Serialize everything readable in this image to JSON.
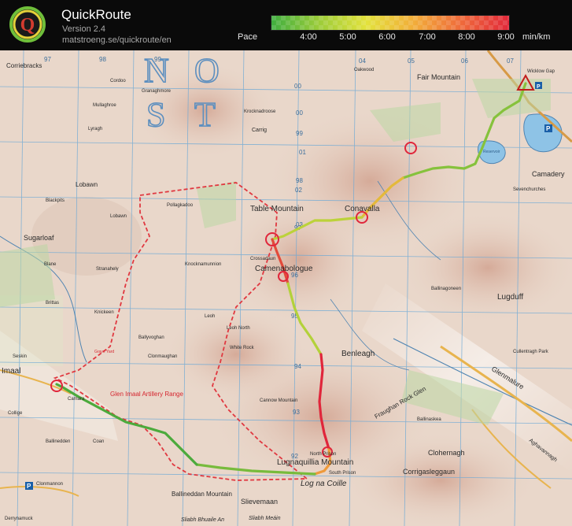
{
  "header": {
    "app_name": "QuickRoute",
    "version": "Version 2.4",
    "url": "matstroeng.se/quickroute/en",
    "pace_label": "Pace",
    "pace_ticks": [
      "4:00",
      "5:00",
      "6:00",
      "7:00",
      "8:00",
      "9:00"
    ],
    "pace_unit": "min/km",
    "pace_colors": [
      "#3fae3f",
      "#9ccc3a",
      "#e3e23c",
      "#f2ad3a",
      "#ef6a3b",
      "#e2283a"
    ],
    "logo_letter": "Q"
  },
  "map": {
    "colors": {
      "route_fast": "#4caa3c",
      "route_slow": "#e0263b",
      "range_boundary": "#e03840",
      "water": "#8ec3e6",
      "grid": "#6aa8d6"
    },
    "grid_labels_top": [
      "97",
      "98",
      "99",
      "00",
      "01",
      "02",
      "03",
      "04",
      "05",
      "06",
      "07"
    ],
    "grid_labels_left": [
      "00",
      "99",
      "98",
      "97",
      "96",
      "95",
      "94",
      "93",
      "92"
    ],
    "letters": [
      "N",
      "O",
      "S",
      "T"
    ],
    "places": {
      "corriebracks": "Corriebracks",
      "cordoo": "Cordoo",
      "granaghmore": "Granaghmore",
      "mullaghroe": "Mullaghroe",
      "lyragh": "Lyragh",
      "oakwood": "Oakwood",
      "fair_mountain": "Fair Mountain",
      "wicklow_gap": "Wicklow Gap",
      "krocknadroose": "Krocknadroose",
      "carrig": "Carrig",
      "camaderry": "Camadery",
      "sevenchurches": "Sevenchurches",
      "lobawn": "Lobawn",
      "lobawn_small": "Lobawn",
      "blackpits": "Blackpits",
      "pollagkadoo": "Pollagkadoo",
      "table_mountain": "Table Mountain",
      "conavalla": "Conavalla",
      "sugarloaf": "Sugarloaf",
      "blane": "Blane",
      "stranahely": "Stranahely",
      "camenabologue": "Camenabologue",
      "crossadaun": "Crossadaun",
      "knocknamunnion": "Knocknamunnion",
      "ballinagoneen": "Ballinagoneen",
      "lugduff": "Lugduff",
      "brittas": "Brittas",
      "knickeen": "Knickeen",
      "leoh": "Leoh",
      "leoh_north": "Leoh North",
      "ballyvoghan": "Ballyvoghan",
      "white_rock": "White Rock",
      "benleagh": "Benleagh",
      "cullentragh_park": "Cullentragh Park",
      "seskin": "Seskin",
      "imaal": "Imaal",
      "clonmaughan": "Clonmaughan",
      "camara": "Camara",
      "glen_imaal_range": "Glen Imaal Artillery Range",
      "cannow_mountain": "Cannow Mountain",
      "fraughan_rock_glen": "Fraughan Rock Glen",
      "glenmalure": "Glenmalure",
      "ballinasloe": "Ballinaskea",
      "clohernagh": "Clohernagh",
      "collige": "Collige",
      "coan": "Coan",
      "ballinedden": "Ballinedden",
      "lugnaquillia": "Lugnaquillia Mountain",
      "north_prison": "North Prison",
      "south_prison": "South Prison",
      "log_na_coille": "Log na Coille",
      "corrigasleggaun": "Corrigasleggaun",
      "ballineddan_mountain": "Ballineddan Mountain",
      "slievemaan": "Slievemaan",
      "sliabh_bhuaile": "Sliabh Bhuaile An",
      "sliabh_meain": "Sliabh Meáin",
      "clonmannon": "Clonmannon",
      "derrynamuck": "Derrynamuck",
      "grave_yard": "Grave Yard",
      "reservoir": "Reservoir",
      "aghavannagh": "Aghavannagh"
    }
  }
}
